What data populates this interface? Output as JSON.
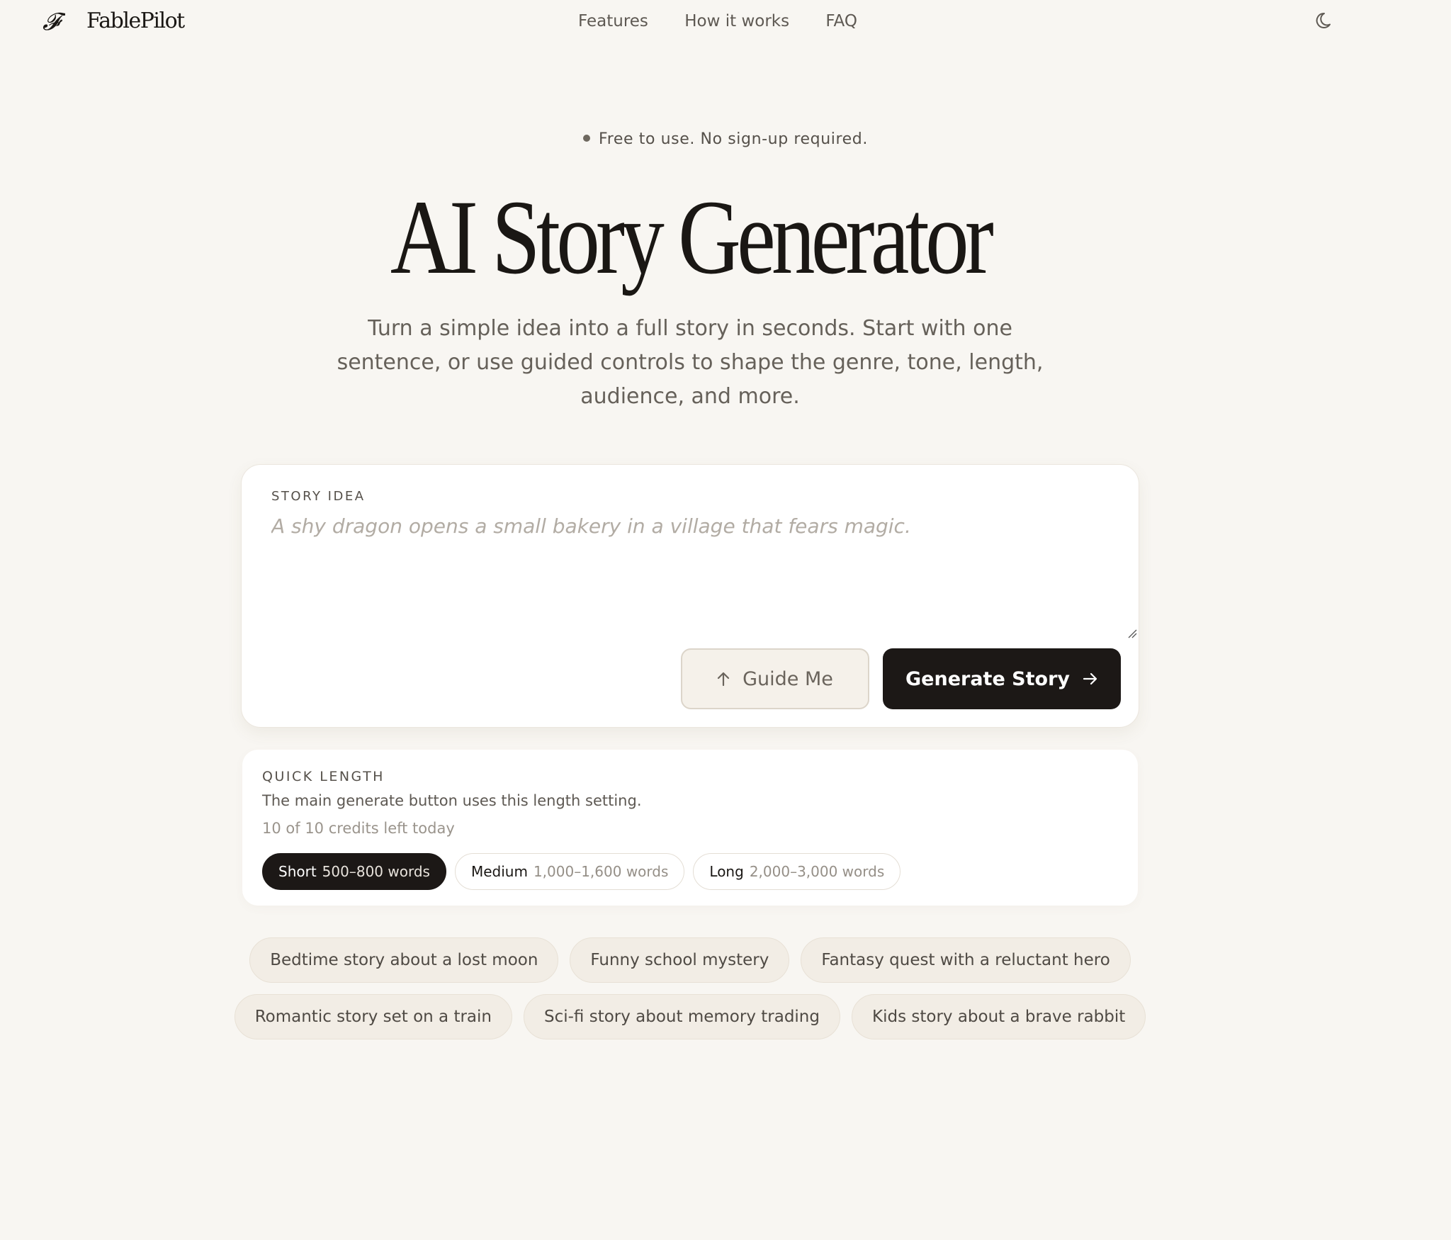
{
  "brand": {
    "name": "FablePilot",
    "logo_letter": "F"
  },
  "nav": {
    "links": [
      "Features",
      "How it works",
      "FAQ"
    ],
    "theme_icon": "moon-icon"
  },
  "hero": {
    "badge": "Free to use. No sign-up required.",
    "title": "AI Story Generator",
    "subtitle": "Turn a simple idea into a full story in seconds. Start with one sentence, or use guided controls to shape the genre, tone, length, audience, and more."
  },
  "story_card": {
    "label": "STORY IDEA",
    "input_value": "",
    "placeholder": "A shy dragon opens a small bakery in a village that fears magic.",
    "guide_button": {
      "label": "Guide Me",
      "icon": "arrow-up-icon"
    },
    "generate_button": {
      "label": "Generate Story",
      "icon": "arrow-right-icon"
    }
  },
  "quick_length": {
    "label": "QUICK LENGTH",
    "description": "The main generate button uses this length setting.",
    "credits": "10 of 10 credits left today",
    "options": [
      {
        "name": "Short",
        "range": "500–800 words",
        "selected": true
      },
      {
        "name": "Medium",
        "range": "1,000–1,600 words",
        "selected": false
      },
      {
        "name": "Long",
        "range": "2,000–3,000 words",
        "selected": false
      }
    ]
  },
  "suggestions": [
    "Bedtime story about a lost moon",
    "Funny school mystery",
    "Fantasy quest with a reluctant hero",
    "Romantic story set on a train",
    "Sci-fi story about memory trading",
    "Kids story about a brave rabbit"
  ],
  "colors": {
    "background": "#f8f6f2",
    "primary": "#1c1816",
    "chip_bg": "#f2ede5",
    "muted_text": "#66615a"
  }
}
